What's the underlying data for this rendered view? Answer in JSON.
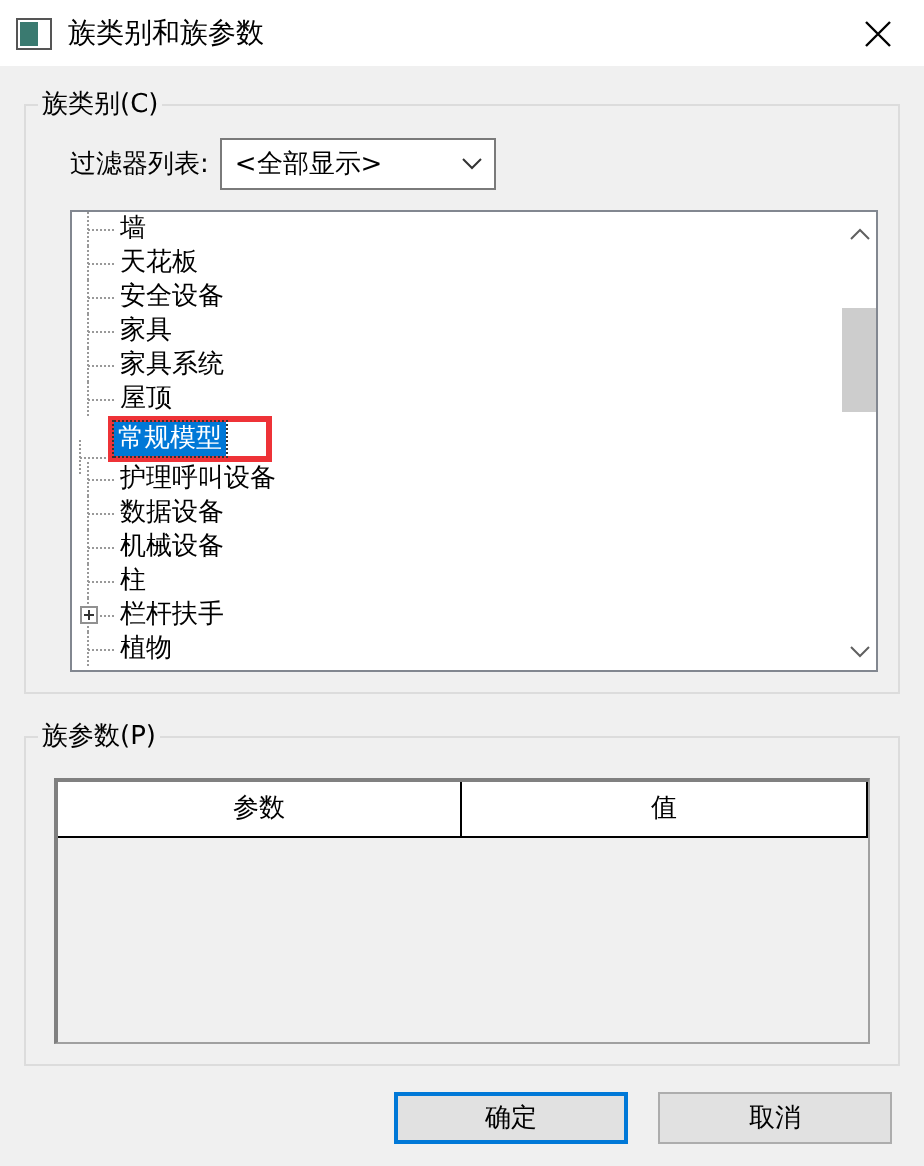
{
  "window": {
    "title": "族类别和族参数"
  },
  "category_group": {
    "label": "族类别(C)",
    "filter": {
      "label": "过滤器列表:",
      "value": "<全部显示>"
    },
    "tree": [
      {
        "label": "墙",
        "kind": "leaf",
        "selected": false,
        "marked": false
      },
      {
        "label": "天花板",
        "kind": "leaf",
        "selected": false,
        "marked": false
      },
      {
        "label": "安全设备",
        "kind": "leaf",
        "selected": false,
        "marked": false
      },
      {
        "label": "家具",
        "kind": "leaf",
        "selected": false,
        "marked": false
      },
      {
        "label": "家具系统",
        "kind": "leaf",
        "selected": false,
        "marked": false
      },
      {
        "label": "屋顶",
        "kind": "leaf",
        "selected": false,
        "marked": false
      },
      {
        "label": "常规模型",
        "kind": "leaf",
        "selected": true,
        "marked": true
      },
      {
        "label": "护理呼叫设备",
        "kind": "leaf",
        "selected": false,
        "marked": false
      },
      {
        "label": "数据设备",
        "kind": "leaf",
        "selected": false,
        "marked": false
      },
      {
        "label": "机械设备",
        "kind": "leaf",
        "selected": false,
        "marked": false
      },
      {
        "label": "柱",
        "kind": "leaf",
        "selected": false,
        "marked": false
      },
      {
        "label": "栏杆扶手",
        "kind": "group",
        "expanded": false,
        "selected": false,
        "marked": false
      },
      {
        "label": "植物",
        "kind": "leaf",
        "selected": false,
        "marked": false
      }
    ]
  },
  "parameter_group": {
    "label": "族参数(P)",
    "table": {
      "columns": [
        "参数",
        "值"
      ]
    }
  },
  "buttons": [
    {
      "label": "确定",
      "default": true
    },
    {
      "label": "取消",
      "default": false
    }
  ]
}
